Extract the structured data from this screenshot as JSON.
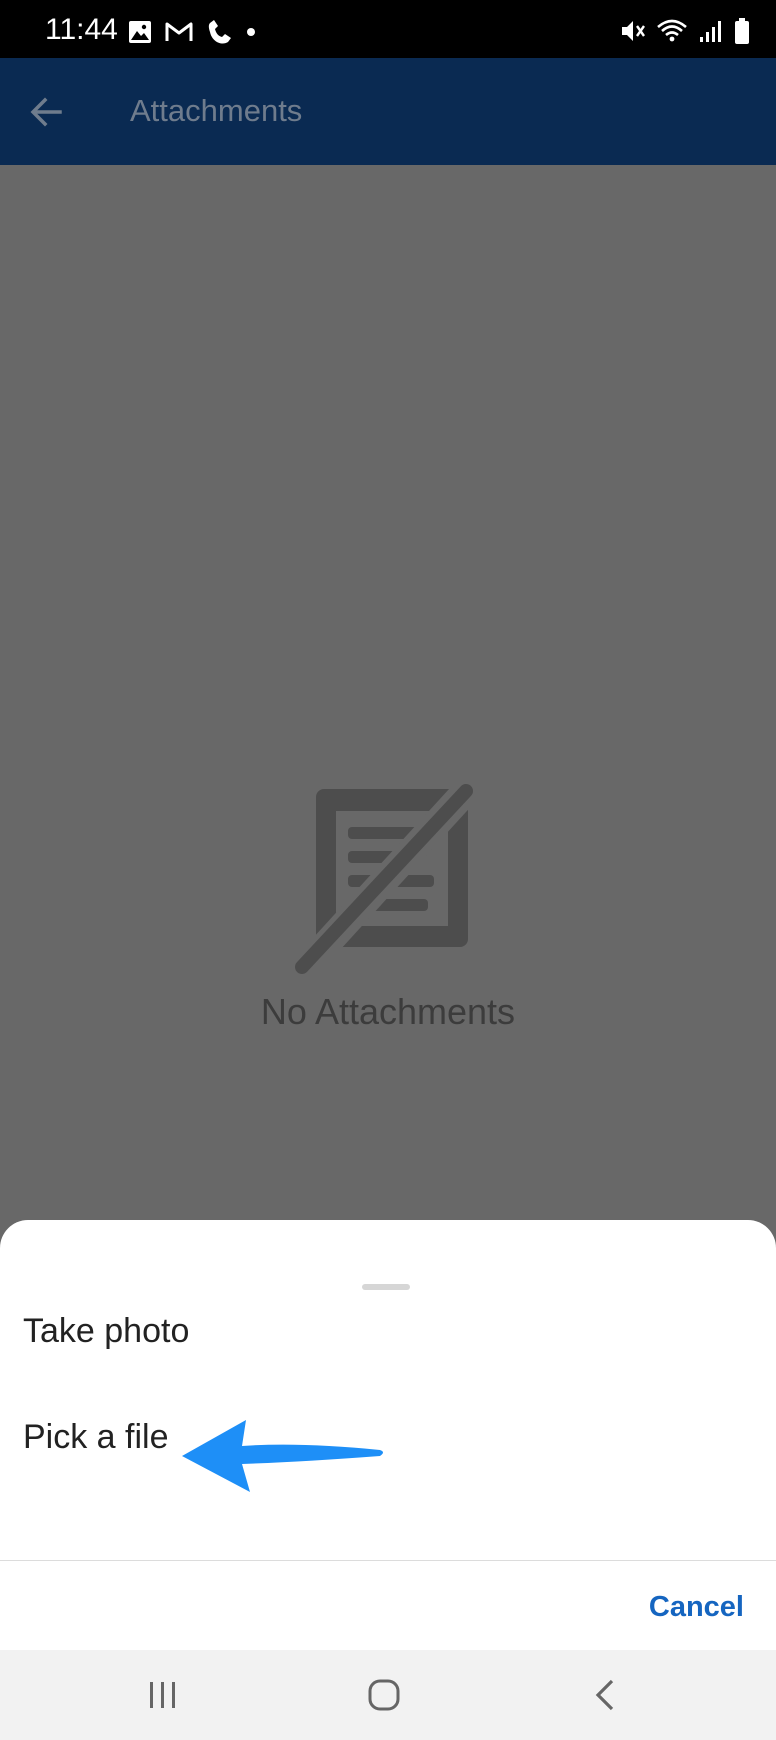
{
  "status_bar": {
    "time": "11:44",
    "left_icons": [
      "gallery-icon",
      "gmail-icon",
      "phone-icon",
      "dot-icon"
    ],
    "right_icons": [
      "mute-icon",
      "wifi-icon",
      "signal-icon",
      "battery-icon"
    ]
  },
  "app_bar": {
    "back_icon": "arrow-left-icon",
    "title": "Attachments"
  },
  "empty_state": {
    "icon": "no-attachment-icon",
    "message": "No Attachments"
  },
  "bottom_sheet": {
    "items": [
      {
        "label": "Take photo"
      },
      {
        "label": "Pick a file"
      }
    ],
    "cancel_label": "Cancel"
  },
  "annotation": {
    "icon": "callout-arrow-icon",
    "color": "#1e8ff7"
  },
  "nav_bar": {
    "icons": [
      "recents-icon",
      "home-icon",
      "back-icon"
    ]
  },
  "colors": {
    "app_bar": "#0a2a52",
    "scrim": "#686868",
    "accent": "#1565c0"
  }
}
